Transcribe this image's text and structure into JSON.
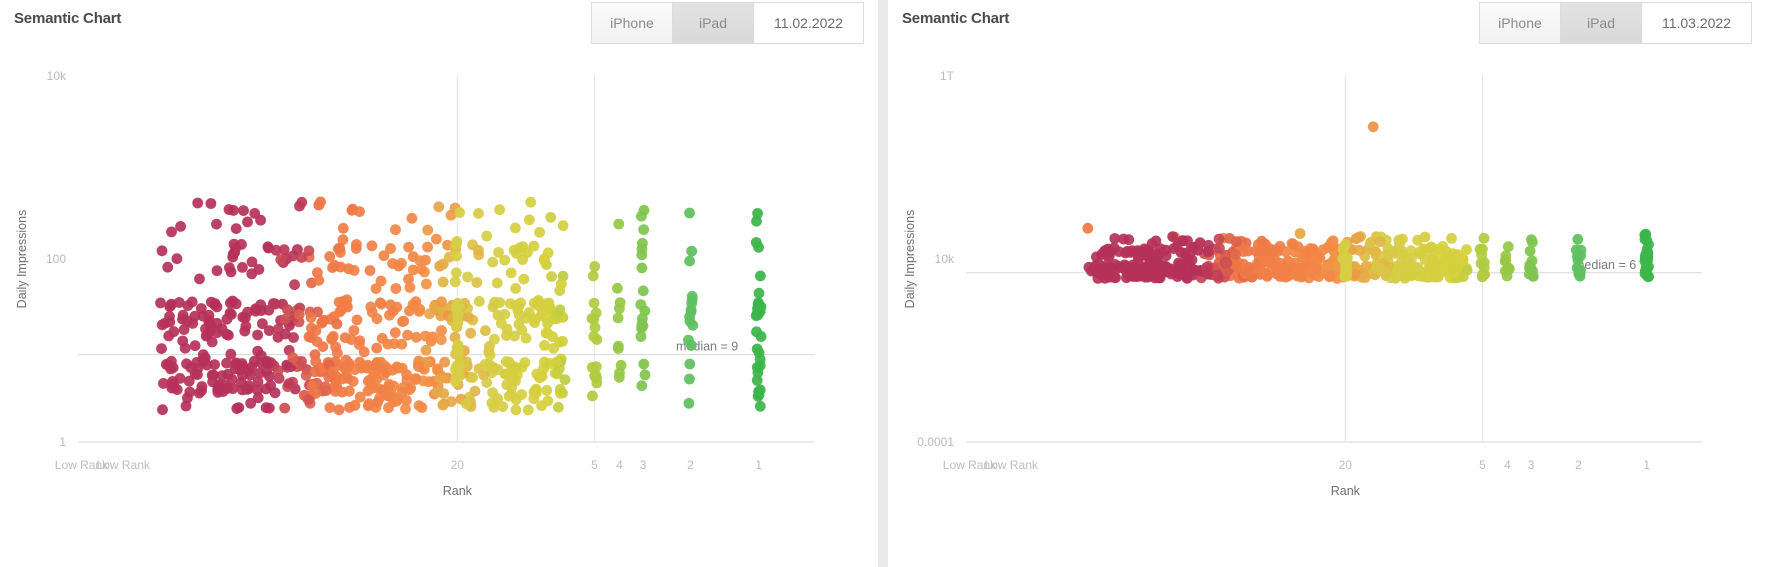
{
  "panels": [
    {
      "title": "Semantic Chart",
      "toolbar": {
        "segments": [
          {
            "label": "iPhone",
            "state": "active"
          },
          {
            "label": "iPad",
            "state": "inactive"
          }
        ],
        "date": "11.02.2022"
      },
      "chart_data": {
        "type": "scatter",
        "title": "Semantic Chart",
        "xlabel": "Rank",
        "ylabel": "Daily Impressions",
        "yscale": "log",
        "ylim": [
          1,
          10000
        ],
        "y_ticks": [
          "10k",
          "100",
          "1"
        ],
        "x_ticks": [
          "Low Rank",
          "Low Rank",
          "20",
          "5",
          "4",
          "3",
          "2",
          "1"
        ],
        "grid": true,
        "annotations": [
          {
            "text": "median = 9",
            "value": 9
          }
        ],
        "colorscale": [
          "#b5315a",
          "#f3813f",
          "#d9d33f",
          "#5fc15f",
          "#3cb54a"
        ],
        "points": [
          {
            "rank_x": 0.245,
            "y": 330,
            "c": "#f3813f"
          },
          {
            "rank_x": 0.258,
            "y": 250,
            "c": "#f3813f"
          },
          {
            "rank_x": 0.302,
            "y": 340,
            "c": "#f3813f"
          },
          {
            "rank_x": 0.33,
            "y": 420,
            "c": "#f3813f"
          },
          {
            "rank_x": 0.368,
            "y": 330,
            "c": "#f3813f"
          },
          {
            "rank_x": 0.455,
            "y": 330,
            "c": "#f3813f"
          },
          {
            "rank_x": 0.52,
            "y": 370,
            "c": "#f3813f"
          },
          {
            "rank_x": 0.535,
            "y": 330,
            "c": "#f3813f"
          },
          {
            "rank_x": 0.288,
            "y": 185,
            "c": "#f3813f"
          },
          {
            "rank_x": 0.337,
            "y": 200,
            "c": "#f3813f"
          },
          {
            "rank_x": 0.378,
            "y": 195,
            "c": "#f3813f"
          },
          {
            "rank_x": 0.458,
            "y": 175,
            "c": "#f3813f"
          },
          {
            "rank_x": 0.488,
            "y": 170,
            "c": "#d9d33f"
          },
          {
            "rank_x": 0.6,
            "y": 175,
            "c": "#d9d33f"
          },
          {
            "rank_x": 0.268,
            "y": 130,
            "c": "#f3813f"
          },
          {
            "rank_x": 0.352,
            "y": 150,
            "c": "#f3813f"
          },
          {
            "rank_x": 0.42,
            "y": 135,
            "c": "#f3813f"
          },
          {
            "rank_x": 0.545,
            "y": 420,
            "c": "#d9d33f"
          },
          {
            "rank_x": 0.742,
            "y": 330,
            "c": "#5fc15f"
          },
          {
            "rank_x": 0.812,
            "y": 360,
            "c": "#3cb54a"
          },
          {
            "rank_x": 0.812,
            "y": 200,
            "c": "#3cb54a"
          },
          {
            "rank_x": 0.88,
            "y": 200,
            "c": "#3cb54a"
          },
          {
            "rank_x": 0.978,
            "y": 430,
            "c": "#3cb54a"
          },
          {
            "rank_x": 0.978,
            "y": 300,
            "c": "#3cb54a"
          }
        ]
      }
    },
    {
      "title": "Semantic Chart",
      "toolbar": {
        "segments": [
          {
            "label": "iPhone",
            "state": "active"
          },
          {
            "label": "iPad",
            "state": "inactive"
          }
        ],
        "date": "11.03.2022"
      },
      "chart_data": {
        "type": "scatter",
        "title": "Semantic Chart",
        "xlabel": "Rank",
        "ylabel": "Daily Impressions",
        "yscale": "log",
        "ylim": [
          0.0001,
          1000000000000
        ],
        "y_ticks": [
          "1T",
          "10k",
          "0.0001"
        ],
        "x_ticks": [
          "Low Rank",
          "Low Rank",
          "20",
          "5",
          "4",
          "3",
          "2",
          "1"
        ],
        "grid": true,
        "annotations": [
          {
            "text": "median = 6",
            "value": 6
          }
        ],
        "colorscale": [
          "#b5315a",
          "#f3813f",
          "#d9d33f",
          "#5fc15f",
          "#3cb54a"
        ],
        "points": [
          {
            "rank_x": 0.585,
            "y": 1000000000.0,
            "c": "#f3813f"
          },
          {
            "rank_x": 0.175,
            "y": 200000,
            "c": "#f3813f"
          },
          {
            "rank_x": 0.3,
            "y": 90000,
            "c": "#f3813f"
          },
          {
            "rank_x": 0.37,
            "y": 80000,
            "c": "#f3813f"
          },
          {
            "rank_x": 0.48,
            "y": 120000,
            "c": "#f3813f"
          }
        ]
      }
    }
  ]
}
